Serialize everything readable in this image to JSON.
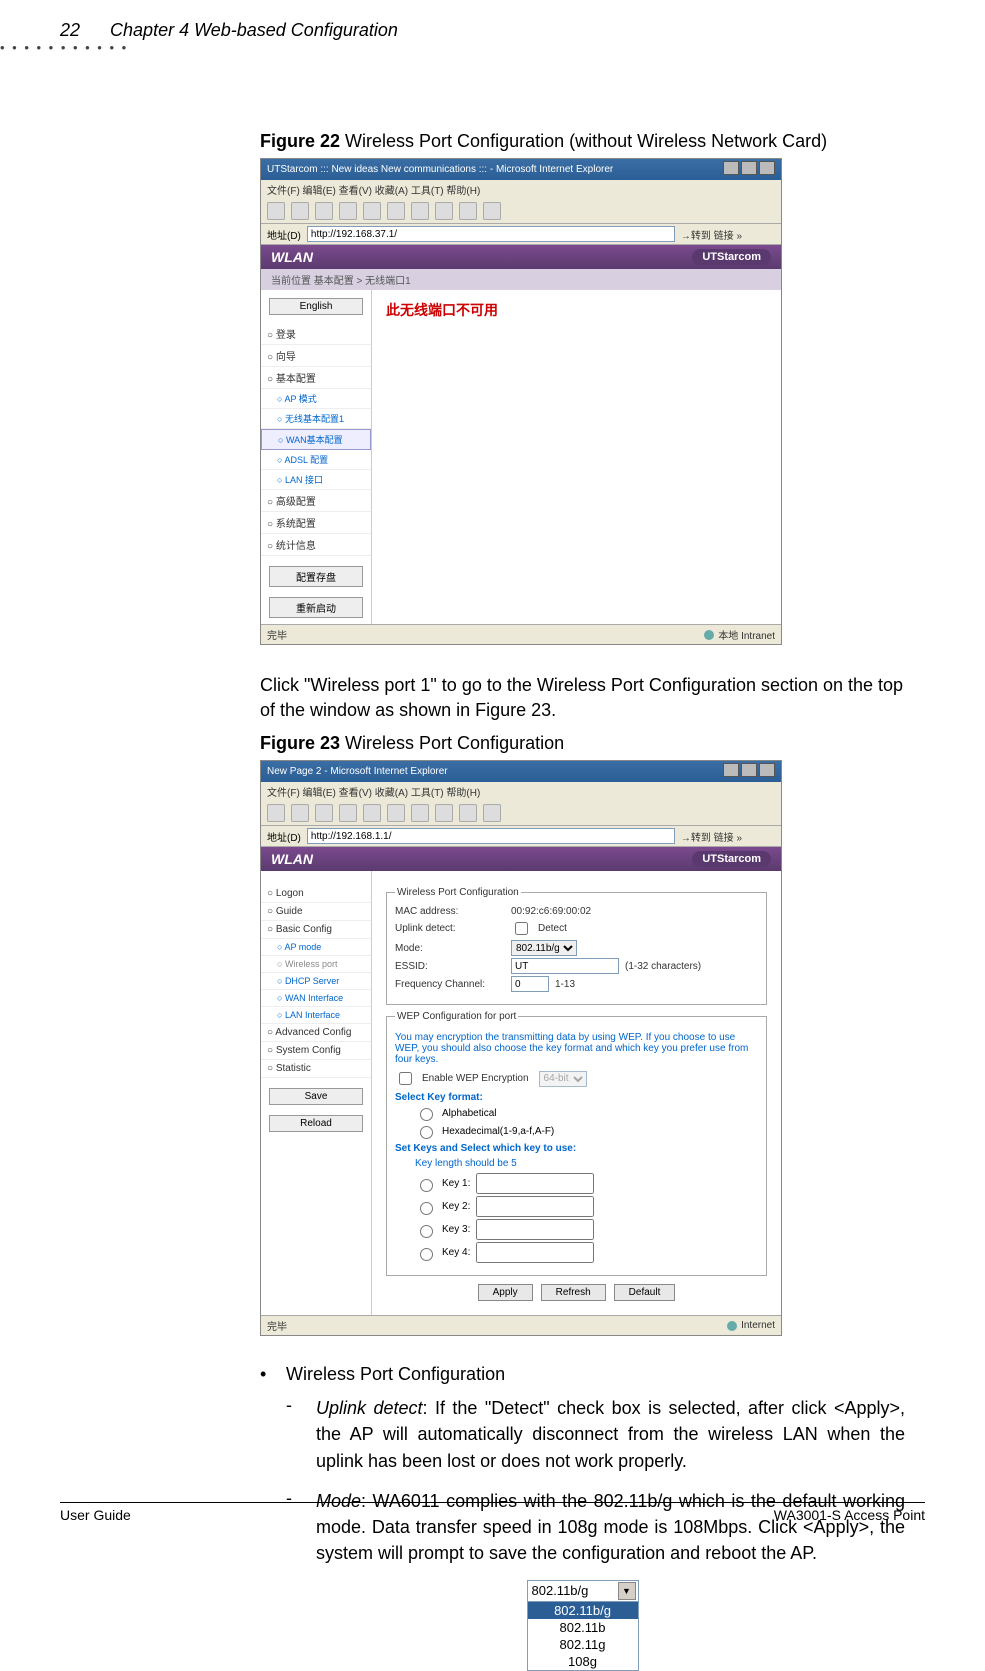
{
  "header": {
    "page_num": "22",
    "chapter": "Chapter 4 Web-based Configuration"
  },
  "figure22": {
    "caption_bold": "Figure 22",
    "caption_rest": " Wireless Port Configuration (without Wireless Network Card)",
    "ie_title": "UTStarcom ::: New ideas New communications ::: - Microsoft Internet Explorer",
    "menubar": "文件(F)   编辑(E)   查看(V)   收藏(A)   工具(T)   帮助(H)",
    "address_label": "地址(D)",
    "address_value": "http://192.168.37.1/",
    "go_label": "→转到  链接 »",
    "wlan_label": "WLAN",
    "brand_label": "UTStarcom",
    "subbar": "当前位置 基本配置 > 无线端口1",
    "english_btn": "English",
    "nav": {
      "logon": "登录",
      "guide": "向导",
      "basic": "基本配置",
      "ap_mode": "AP 模式",
      "wireless_port": "无线基本配置1",
      "wan": "WAN基本配置",
      "adsl": "ADSL 配置",
      "lan": "LAN 接口",
      "advanced": "高级配置",
      "system": "系统配置",
      "statistic": "统计信息",
      "save": "配置存盘",
      "reload": "重新启动"
    },
    "red_msg": "此无线端口不可用",
    "status_done": "完毕",
    "status_zone": "本地 Intranet"
  },
  "para1": "Click \"Wireless port 1\" to go to the Wireless Port Configuration section on the top of the window as shown in Figure 23.",
  "figure23": {
    "caption_bold": "Figure 23",
    "caption_rest": " Wireless Port Configuration",
    "ie_title": "New Page 2 - Microsoft Internet Explorer",
    "menubar": "文件(F)   编辑(E)   查看(V)   收藏(A)   工具(T)   帮助(H)",
    "address_label": "地址(D)",
    "address_value": "http://192.168.1.1/",
    "go_label": "→转到  链接 »",
    "wlan_label": "WLAN",
    "brand_label": "UTStarcom",
    "nav": {
      "logon": "Logon",
      "guide": "Guide",
      "basic": "Basic Config",
      "ap_mode": "AP mode",
      "wireless_port": "Wireless port",
      "dhcp": "DHCP Server",
      "wan": "WAN Interface",
      "lan": "LAN Interface",
      "advanced": "Advanced Config",
      "system": "System Config",
      "statistic": "Statistic",
      "save": "Save",
      "reload": "Reload"
    },
    "wpc_legend": "Wireless Port Configuration",
    "mac_label": "MAC address:",
    "mac_value": "00:92:c6:69:00:02",
    "uplink_label": "Uplink detect:",
    "uplink_chk": "Detect",
    "mode_label": "Mode:",
    "mode_value": "802.11b/g",
    "essid_label": "ESSID:",
    "essid_value": "UT",
    "essid_hint": "(1-32 characters)",
    "freq_label": "Frequency Channel:",
    "freq_value": "0",
    "freq_hint": "1-13",
    "wep_legend": "WEP Configuration for port",
    "wep_help": "You may encryption the transmitting data by using WEP. If you choose to use WEP, you should also choose the key format and which key you prefer use from four keys.",
    "enable_wep": "Enable WEP Encryption",
    "wep_bits": "64-bit",
    "select_key_format": "Select Key format:",
    "fmt_alpha": "Alphabetical",
    "fmt_hex": "Hexadecimal(1-9,a-f,A-F)",
    "set_keys": "Set Keys and Select which key to use:",
    "key_len_hint": "Key length should be 5",
    "key1": "Key 1:",
    "key2": "Key 2:",
    "key3": "Key 3:",
    "key4": "Key 4:",
    "btn_apply": "Apply",
    "btn_refresh": "Refresh",
    "btn_default": "Default",
    "status_done": "完毕",
    "status_zone": "Internet"
  },
  "bullets": {
    "main": "Wireless Port Configuration",
    "uplink_lead": "Uplink detect",
    "uplink_rest": ": If the \"Detect\" check box is selected, after click <Apply>, the AP will automatically disconnect from the wireless LAN when the uplink has been lost or does not work properly.",
    "mode_lead": "Mode",
    "mode_rest": ": WA6011 complies with the 802.11b/g which is the default working mode. Data transfer speed in 108g mode is 108Mbps. Click <Apply>, the system will prompt to save the configuration and reboot the AP."
  },
  "dropdown": {
    "top": "802.11b/g",
    "opt1": "802.11b/g",
    "opt2": "802.11b",
    "opt3": "802.11g",
    "opt4": "108g"
  },
  "footer": {
    "left": "User Guide",
    "right": "WA3001-S Access Point"
  }
}
